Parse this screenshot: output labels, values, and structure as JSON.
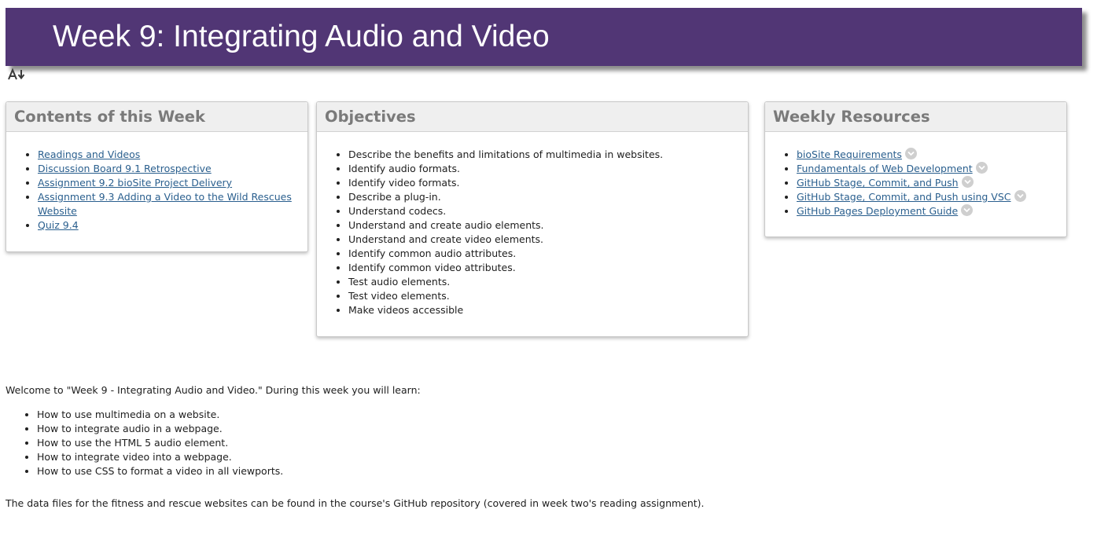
{
  "banner": {
    "title": "Week 9: Integrating Audio and Video"
  },
  "contents": {
    "heading": "Contents of this Week",
    "links": [
      "Readings and Videos",
      "Discussion Board 9.1 Retrospective",
      "Assignment 9.2 bioSite Project Delivery",
      "Assignment 9.3 Adding a Video to the Wild Rescues Website",
      "Quiz 9.4"
    ]
  },
  "objectives": {
    "heading": "Objectives",
    "items": [
      "Describe the benefits and limitations of multimedia in websites.",
      "Identify audio formats.",
      "Identify video formats.",
      "Describe a plug-in.",
      "Understand codecs.",
      "Understand and create audio elements.",
      "Understand and create video elements.",
      "Identify common audio attributes.",
      "Identify common video attributes.",
      "Test audio elements.",
      "Test video elements.",
      "Make videos accessible"
    ]
  },
  "resources": {
    "heading": "Weekly Resources",
    "links": [
      "bioSite Requirements",
      "Fundamentals of Web Development",
      "GitHub Stage, Commit, and Push",
      "GitHub Stage, Commit, and Push using VSC",
      "GitHub Pages Deployment Guide"
    ]
  },
  "intro": "Welcome to \"Week 9 - Integrating Audio and Video.\"  During this week you will learn:",
  "learn": [
    "How to use multimedia on a website.",
    "How to integrate audio in a webpage.",
    "How to use the HTML 5 audio element.",
    "How to integrate video into a webpage.",
    "How to use CSS to format a video in all viewports."
  ],
  "data_note": "The data files for the fitness and rescue websites can be found in the course's GitHub repository (covered in week two's reading assignment).",
  "colors": {
    "banner": "#513675",
    "link": "#2a5f8e",
    "heading": "#7a7a7a"
  },
  "icons": {
    "sort": "sort-az-icon",
    "expand": "chevron-down-icon"
  }
}
